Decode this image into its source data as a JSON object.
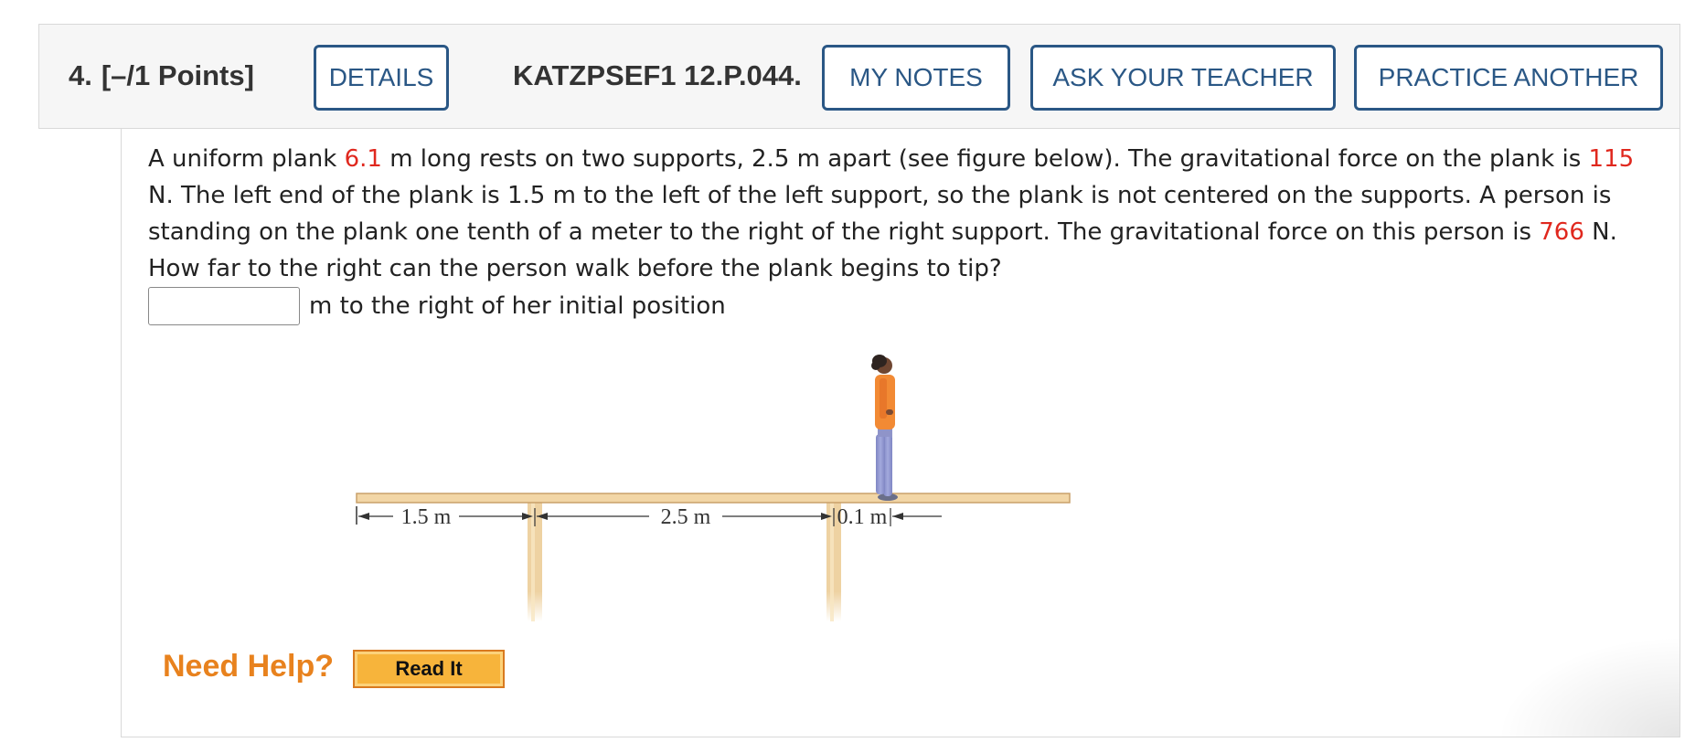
{
  "header": {
    "number": "4.",
    "points": "[–/1 Points]",
    "details_label": "DETAILS",
    "problem_code": "KATZPSEF1 12.P.044.",
    "my_notes_label": "MY NOTES",
    "ask_teacher_label": "ASK YOUR TEACHER",
    "practice_another_label": "PRACTICE ANOTHER"
  },
  "problem": {
    "t1": "A uniform plank ",
    "length_value": "6.1",
    "t2": " m long rests on two supports, 2.5 m apart (see figure below). The gravitational force on the plank is ",
    "plank_force_value": "115",
    "t3": " N. The left end of the plank is 1.5 m to the left of the left support, so the plank is not centered on the supports. A person is standing on the plank one tenth of a meter to the right of the right support. The gravitational force on this person is ",
    "person_force_value": "766",
    "t4": " N. How far to the right can the person walk before the plank begins to tip?"
  },
  "answer": {
    "value": "",
    "unit_text": "m to the right of her initial position"
  },
  "figure": {
    "label_left": "1.5 m",
    "label_middle": "2.5 m",
    "label_right": "0.1 m"
  },
  "help": {
    "label": "Need Help?",
    "read_it_label": "Read It"
  },
  "colors": {
    "button_blue": "#2a5785",
    "highlight_red": "#e0281e",
    "help_orange": "#e8821e",
    "read_it_fill": "#f7b43b",
    "plank_tan": "#f2d6a6"
  }
}
